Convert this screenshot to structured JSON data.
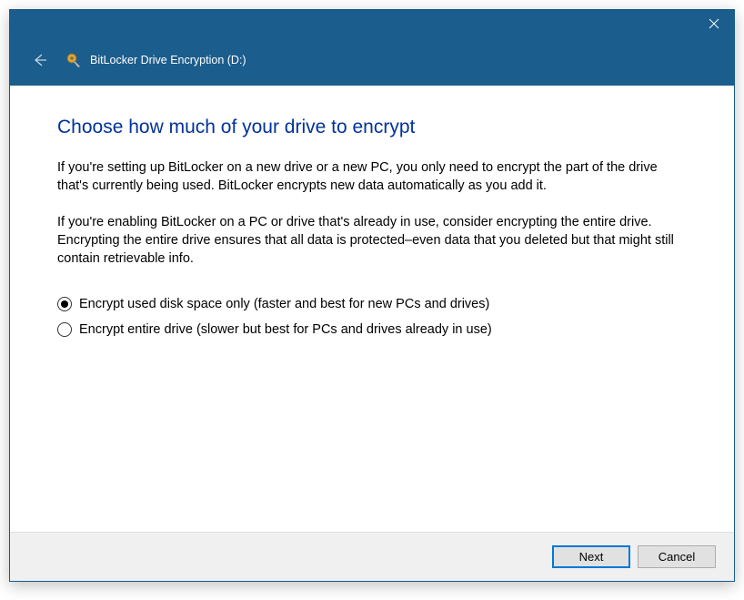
{
  "titlebar": {
    "title": "BitLocker Drive Encryption (D:)"
  },
  "content": {
    "heading": "Choose how much of your drive to encrypt",
    "paragraph1": "If you're setting up BitLocker on a new drive or a new PC, you only need to encrypt the part of the drive that's currently being used. BitLocker encrypts new data automatically as you add it.",
    "paragraph2": "If you're enabling BitLocker on a PC or drive that's already in use, consider encrypting the entire drive. Encrypting the entire drive ensures that all data is protected–even data that you deleted but that might still contain retrievable info."
  },
  "options": {
    "option1": {
      "label": "Encrypt used disk space only (faster and best for new PCs and drives)",
      "selected": true
    },
    "option2": {
      "label": "Encrypt entire drive (slower but best for PCs and drives already in use)",
      "selected": false
    }
  },
  "footer": {
    "next": "Next",
    "cancel": "Cancel"
  }
}
